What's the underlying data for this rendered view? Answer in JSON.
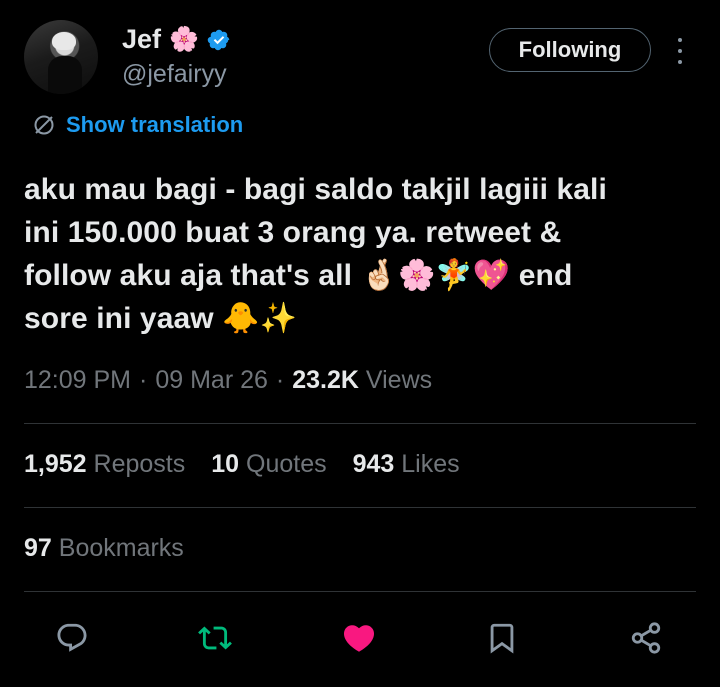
{
  "author": {
    "name": "Jef",
    "name_emoji": "🌸",
    "handle": "@jefairyy",
    "verified": true
  },
  "follow_button": {
    "label": "Following"
  },
  "translation": {
    "label": "Show translation"
  },
  "tweet": {
    "line1": "aku mau bagi - bagi saldo takjil lagiii kali",
    "line2": "ini 150.000 buat 3 orang ya. retweet &",
    "line3_text": "follow aku aja that's all",
    "line3_emojis": "🤞🏻🌸🧚💖",
    "line3_end": "end",
    "line4_text": "sore ini yaaw",
    "line4_emojis": "🐥✨"
  },
  "meta": {
    "time": "12:09 PM",
    "separator": "·",
    "date": "09 Mar 26",
    "views_count": "23.2K",
    "views_label": "Views"
  },
  "stats": {
    "reposts_count": "1,952",
    "reposts_label": "Reposts",
    "quotes_count": "10",
    "quotes_label": "Quotes",
    "likes_count": "943",
    "likes_label": "Likes",
    "bookmarks_count": "97",
    "bookmarks_label": "Bookmarks"
  },
  "colors": {
    "accent": "#1d9bf0",
    "repost_active": "#00ba7c",
    "like_active": "#f91880",
    "muted": "#71767b",
    "background": "#000000"
  },
  "icons": {
    "reply": "reply-icon",
    "repost": "repost-icon",
    "like": "heart-icon",
    "bookmark": "bookmark-icon",
    "share": "share-icon"
  }
}
